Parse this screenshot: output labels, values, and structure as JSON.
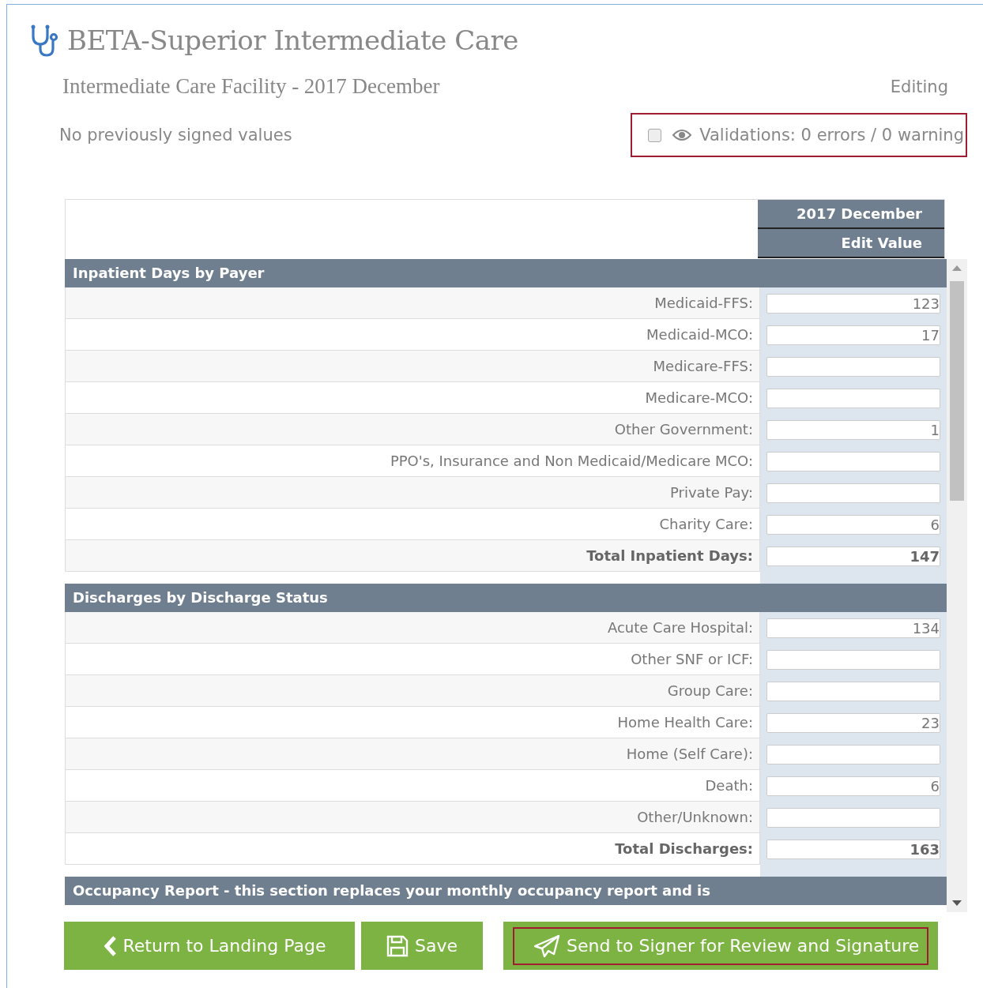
{
  "app": {
    "title": "BETA-Superior Intermediate Care"
  },
  "report": {
    "title": "Intermediate Care Facility - 2017 December",
    "mode": "Editing"
  },
  "signed_note": "No previously signed values",
  "validations": {
    "checked": false,
    "text": "Validations: 0 errors / 0 warning"
  },
  "table": {
    "columns": [
      "2017 December",
      "Edit Value"
    ],
    "sections": [
      {
        "title": "Inpatient Days by Payer",
        "rows": [
          {
            "label": "Medicaid-FFS:",
            "value": "123",
            "total": false
          },
          {
            "label": "Medicaid-MCO:",
            "value": "17",
            "total": false
          },
          {
            "label": "Medicare-FFS:",
            "total": false
          },
          {
            "label": "Medicare-MCO:",
            "total": false
          },
          {
            "label": "Other Government:",
            "value": "1",
            "total": false
          },
          {
            "label": "PPO's, Insurance and Non Medicaid/Medicare MCO:",
            "total": false
          },
          {
            "label": "Private Pay:",
            "total": false
          },
          {
            "label": "Charity Care:",
            "value": "6",
            "total": false
          },
          {
            "label": "Total Inpatient Days:",
            "value": "147",
            "total": true
          }
        ]
      },
      {
        "title": "Discharges by Discharge Status",
        "rows": [
          {
            "label": "Acute Care Hospital:",
            "value": "134",
            "total": false
          },
          {
            "label": "Other SNF or ICF:",
            "total": false
          },
          {
            "label": "Group Care:",
            "total": false
          },
          {
            "label": "Home Health Care:",
            "value": "23",
            "total": false
          },
          {
            "label": "Home (Self Care):",
            "total": false
          },
          {
            "label": "Death:",
            "value": "6",
            "total": false
          },
          {
            "label": "Other/Unknown:",
            "total": false
          },
          {
            "label": "Total Discharges:",
            "value": "163",
            "total": true
          }
        ]
      },
      {
        "title": "Occupancy Report - this section replaces your monthly occupancy report and is"
      }
    ]
  },
  "buttons": [
    {
      "label": "Return to Landing Page",
      "kind": "back",
      "focused": false
    },
    {
      "label": "Save",
      "kind": "save",
      "focused": false
    },
    {
      "label": "Send to Signer for Review and Signature",
      "kind": "send",
      "focused": true
    }
  ]
}
